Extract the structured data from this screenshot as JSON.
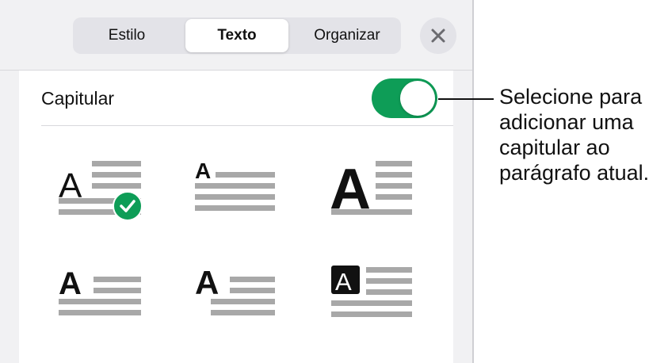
{
  "tabs": [
    {
      "label": "Estilo",
      "active": false
    },
    {
      "label": "Texto",
      "active": true
    },
    {
      "label": "Organizar",
      "active": false
    }
  ],
  "close_icon": "close-icon",
  "drop_cap": {
    "label": "Capitular",
    "enabled": true,
    "toggle_color": "#0e9d57"
  },
  "styles": [
    {
      "letter": "A",
      "variant": "regular-3-lines",
      "selected": true
    },
    {
      "letter": "A",
      "variant": "small-bold-2-lines",
      "selected": false
    },
    {
      "letter": "A",
      "variant": "large-bold-3-lines",
      "selected": false
    },
    {
      "letter": "A",
      "variant": "bold-2-lines",
      "selected": false
    },
    {
      "letter": "A",
      "variant": "bold-inset",
      "selected": false
    },
    {
      "letter": "A",
      "variant": "boxed",
      "selected": false
    }
  ],
  "selected_check_color": "#0e9d57",
  "callout": "Selecione para adicionar uma capitular ao parágrafo atual."
}
